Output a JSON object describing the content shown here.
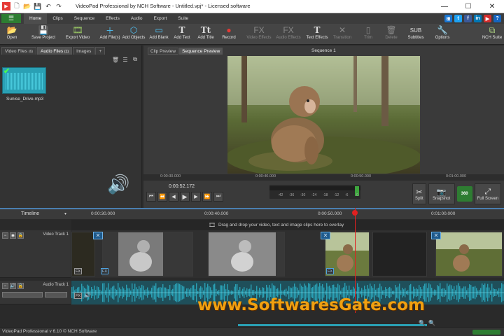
{
  "window": {
    "title": "VideoPad Professional by NCH Software - Untitled.vpj* - Licensed software"
  },
  "menu": {
    "tabs": [
      "Home",
      "Clips",
      "Sequence",
      "Effects",
      "Audio",
      "Export",
      "Suite"
    ],
    "active_tab": "Home"
  },
  "toolbar": {
    "open": "Open",
    "save_project": "Save Project",
    "export_video": "Export Video",
    "add_files": "Add File(s)",
    "add_objects": "Add Objects",
    "add_blank": "Add Blank",
    "add_text": "Add Text",
    "add_title": "Add Title",
    "record": "Record",
    "video_effects": "Video Effects",
    "audio_effects": "Audio Effects",
    "text_effects": "Text Effects",
    "transition": "Transition",
    "trim": "Trim",
    "delete": "Delete",
    "subtitles": "Subtitles",
    "options": "Options",
    "nch_suite": "NCH Suite"
  },
  "media_panel": {
    "tabs": [
      "Video Files",
      "(6)",
      "Audio Files",
      "(1)",
      "Images",
      "+"
    ],
    "clip_name": "Sunise_Drive.mp3"
  },
  "preview": {
    "tabs": [
      "Clip Preview",
      "Sequence Preview"
    ],
    "sequence_title": "Sequence 1",
    "ruler_ticks": [
      "0:00:30.000",
      "0:00:40.000",
      "0:00:50.000",
      "0:01:00.000"
    ],
    "timecode": "0:00:52.172",
    "meter_scale": [
      "-42",
      "-36",
      "-30",
      "-24",
      "-18",
      "-12",
      "-6",
      "0"
    ],
    "split": "Split",
    "snapshot": "Snapshot",
    "badge_360": "360",
    "full_screen": "Full Screen"
  },
  "timeline": {
    "label": "Timeline",
    "ticks": [
      "0:00:30.000",
      "0:00:40.000",
      "0:00:50.000",
      "0:01:00.000"
    ],
    "overlay_hint": "Drag and drop your video, text and image clips here to overlay",
    "video_track": "Video Track 1",
    "audio_track": "Audio Track 1",
    "fx_label": "FX"
  },
  "watermark": "www.SoftwaresGate.com",
  "status": "VideoPad Professional v 6.10 © NCH Software",
  "colors": {
    "accent_green": "#2e7d32",
    "playhead": "#e02020",
    "audio_wave": "#2aa0b4",
    "watermark": "#f0a010"
  }
}
